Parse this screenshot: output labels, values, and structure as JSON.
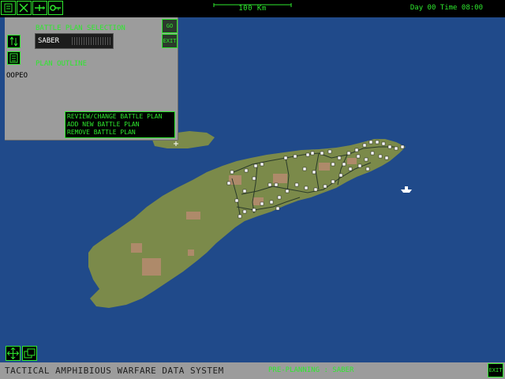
{
  "topbar": {
    "scale_label": "100 Km",
    "time_label": "Day 00  Time 08:00",
    "buttons": [
      "file-icon",
      "tools-icon",
      "aircraft-icon",
      "key-icon"
    ]
  },
  "panel": {
    "title": "BATTLE PLAN SELECTION",
    "plan_name": "SABER",
    "outline_label": "PLAN OUTLINE",
    "side_label": "OOPEO",
    "go_label": "GO",
    "exit_label": "EXIT",
    "menu": [
      "REVIEW/CHANGE BATTLE PLAN",
      "ADD NEW BATTLE PLAN",
      "REMOVE BATTLE PLAN"
    ]
  },
  "bottombar": {
    "app_title": "TACTICAL AMPHIBIOUS WARFARE DATA SYSTEM",
    "status": "PRE-PLANNING : SABER",
    "exit_label": "EXIT"
  },
  "map": {
    "sea_color": "#204a8a",
    "land_color": "#7b8a4a",
    "terrain_color": "#ae8a6a"
  }
}
